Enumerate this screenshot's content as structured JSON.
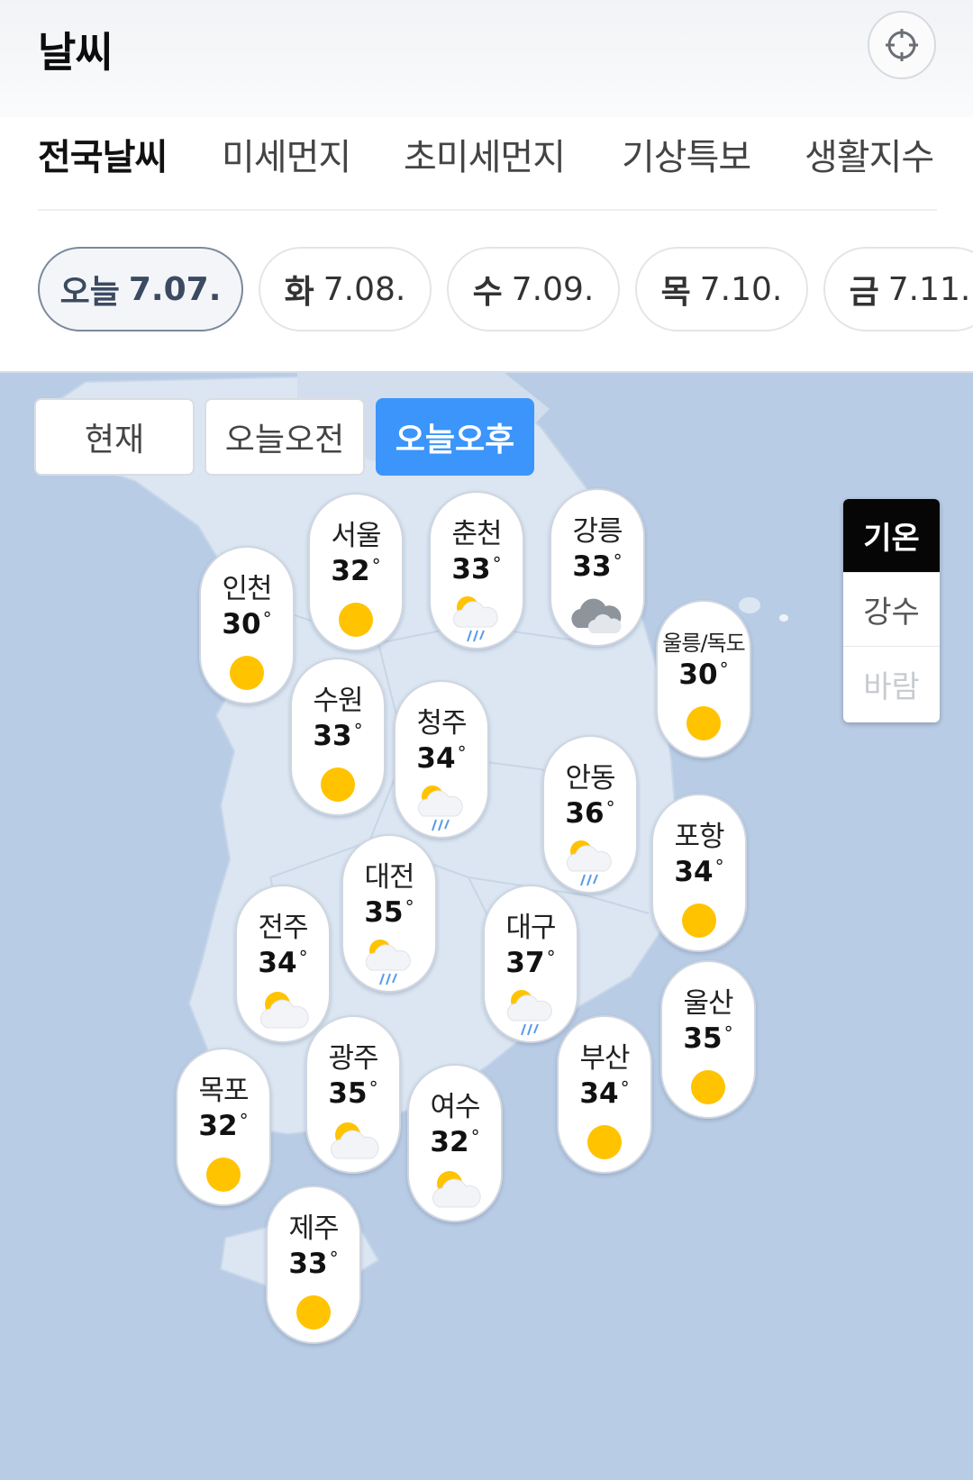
{
  "header": {
    "title": "날씨",
    "location_icon": "crosshair-icon"
  },
  "tabs": [
    {
      "label": "전국날씨",
      "active": true
    },
    {
      "label": "미세먼지"
    },
    {
      "label": "초미세먼지"
    },
    {
      "label": "기상특보"
    },
    {
      "label": "생활지수"
    }
  ],
  "dates": [
    {
      "dow": "오늘",
      "date": "7.07.",
      "active": true
    },
    {
      "dow": "화",
      "date": "7.08."
    },
    {
      "dow": "수",
      "date": "7.09."
    },
    {
      "dow": "목",
      "date": "7.10."
    },
    {
      "dow": "금",
      "date": "7.11."
    }
  ],
  "time_buttons": [
    {
      "label": "현재"
    },
    {
      "label": "오늘오전"
    },
    {
      "label": "오늘오후",
      "active": true
    }
  ],
  "layers": [
    {
      "label": "기온",
      "active": true
    },
    {
      "label": "강수"
    },
    {
      "label": "바람",
      "disabled": true
    }
  ],
  "degree_symbol": "°",
  "colors": {
    "accent": "#3b95fb",
    "sun": "#ffc300",
    "map_sea": "#b9cce5",
    "map_land": "#dbe6f2"
  },
  "cities": [
    {
      "name": "서울",
      "temp": "32",
      "icon": "sun-icon"
    },
    {
      "name": "춘천",
      "temp": "33",
      "icon": "sun-cloud-rain-icon"
    },
    {
      "name": "강릉",
      "temp": "33",
      "icon": "cloud-icon"
    },
    {
      "name": "인천",
      "temp": "30",
      "icon": "sun-icon"
    },
    {
      "name": "울릉/독도",
      "temp": "30",
      "icon": "sun-icon"
    },
    {
      "name": "수원",
      "temp": "33",
      "icon": "sun-icon"
    },
    {
      "name": "청주",
      "temp": "34",
      "icon": "sun-cloud-rain-icon"
    },
    {
      "name": "안동",
      "temp": "36",
      "icon": "sun-cloud-rain-icon"
    },
    {
      "name": "포항",
      "temp": "34",
      "icon": "sun-icon"
    },
    {
      "name": "대전",
      "temp": "35",
      "icon": "sun-cloud-rain-icon"
    },
    {
      "name": "전주",
      "temp": "34",
      "icon": "sun-cloud-icon"
    },
    {
      "name": "대구",
      "temp": "37",
      "icon": "sun-cloud-rain-icon"
    },
    {
      "name": "울산",
      "temp": "35",
      "icon": "sun-icon"
    },
    {
      "name": "광주",
      "temp": "35",
      "icon": "sun-cloud-icon"
    },
    {
      "name": "부산",
      "temp": "34",
      "icon": "sun-icon"
    },
    {
      "name": "목포",
      "temp": "32",
      "icon": "sun-icon"
    },
    {
      "name": "여수",
      "temp": "32",
      "icon": "sun-cloud-icon"
    },
    {
      "name": "제주",
      "temp": "33",
      "icon": "sun-icon"
    }
  ]
}
